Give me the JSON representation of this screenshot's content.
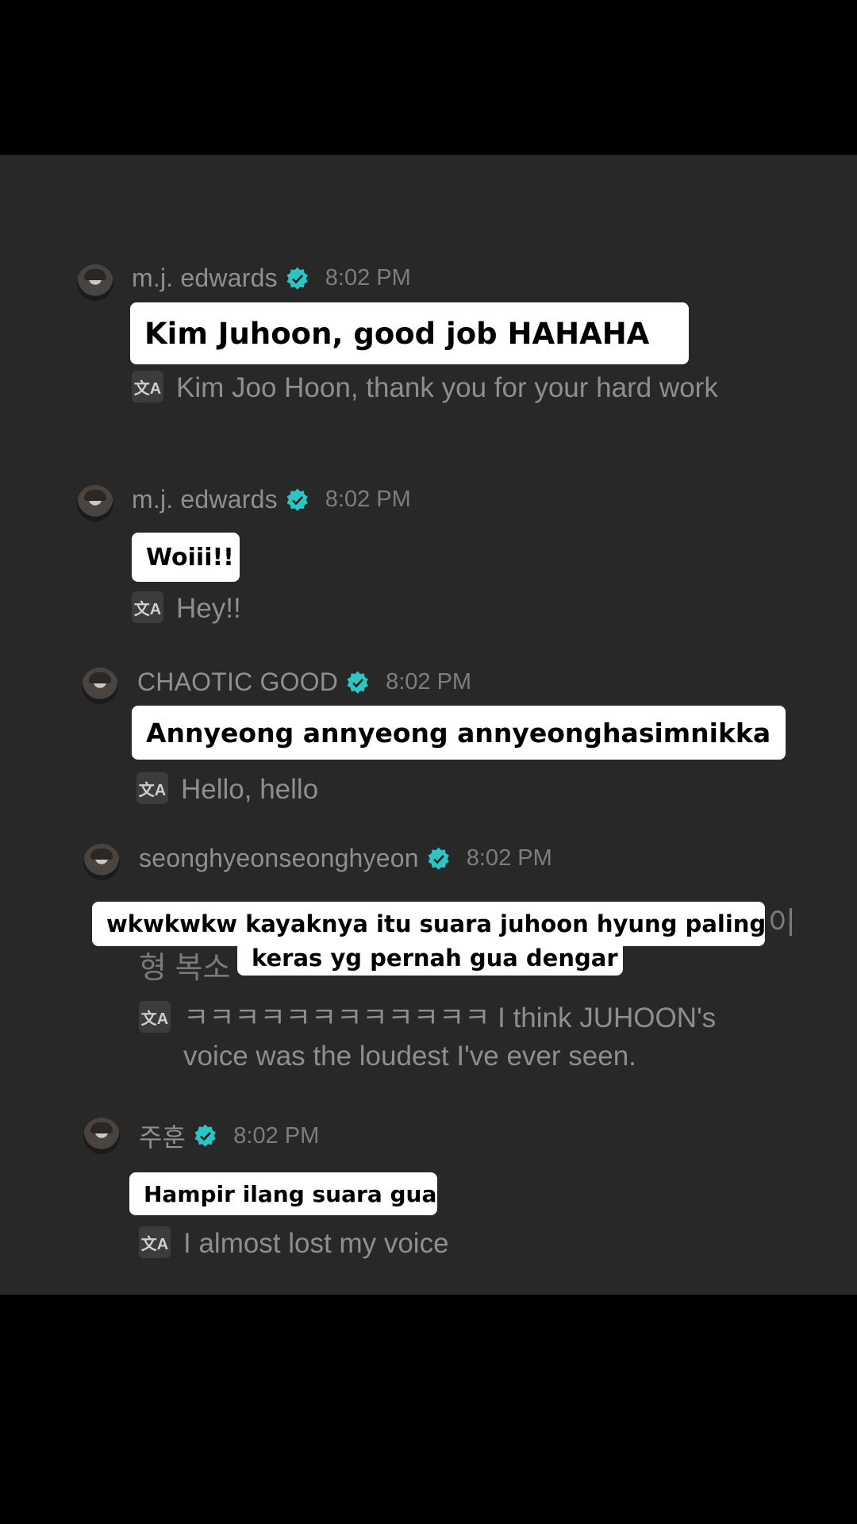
{
  "messages": [
    {
      "username": "m.j. edwards",
      "time": "8:02 PM",
      "caption": "Kim Juhoon, good job HAHAHA",
      "translation": "Kim Joo Hoon, thank you for your hard work",
      "translate_icon": "文A"
    },
    {
      "username": "m.j. edwards",
      "time": "8:02 PM",
      "caption": "Woiii!!",
      "translation": "Hey!!",
      "translate_icon": "文A"
    },
    {
      "username": "CHAOTIC GOOD",
      "time": "8:02 PM",
      "caption": "Annyeong annyeong annyeonghasimnikka",
      "translation": "Hello, hello",
      "translate_icon": "文A"
    },
    {
      "username": "seonghyeonseonghyeon",
      "time": "8:02 PM",
      "caption_line1": "wkwkwkw kayaknya itu suara juhoon hyung paling",
      "caption_line2": "keras yg pernah gua dengar",
      "original_partial_left": "형 복소",
      "original_partial_right": "이",
      "translation": "ㅋㅋㅋㅋㅋㅋㅋㅋㅋㅋㅋㅋ I think JUHOON's voice was the loudest I've ever seen.",
      "translate_icon": "文A"
    },
    {
      "username": "주훈",
      "time": "8:02 PM",
      "caption": "Hampir ilang suara gua",
      "translation": "I almost lost my voice",
      "translate_icon": "文A"
    }
  ],
  "colors": {
    "background": "#282828",
    "verified_badge": "#2ec4c4",
    "caption_bg": "#ffffff"
  }
}
